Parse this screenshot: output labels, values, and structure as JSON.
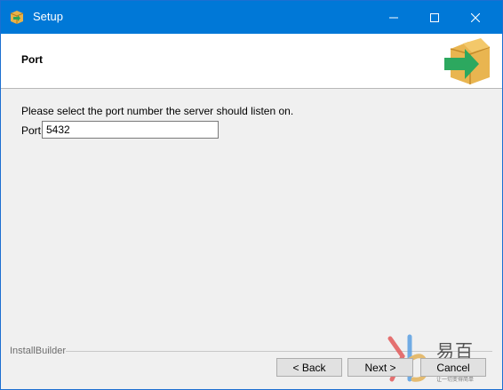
{
  "window": {
    "title": "Setup",
    "accent": "#0078d7"
  },
  "header": {
    "title": "Port"
  },
  "content": {
    "prompt": "Please select the port number the server should listen on.",
    "port_label": "Port",
    "port_value": "5432"
  },
  "footer": {
    "brand": "InstallBuilder",
    "back_label": "< Back",
    "next_label": "Next >",
    "cancel_label": "Cancel"
  },
  "watermark": {
    "text": "易百",
    "sub": "让一切变得简单"
  },
  "icons": [
    "app-box-icon",
    "minimize-icon",
    "maximize-icon",
    "close-icon",
    "box-arrow-icon",
    "watermark-logo-icon"
  ]
}
